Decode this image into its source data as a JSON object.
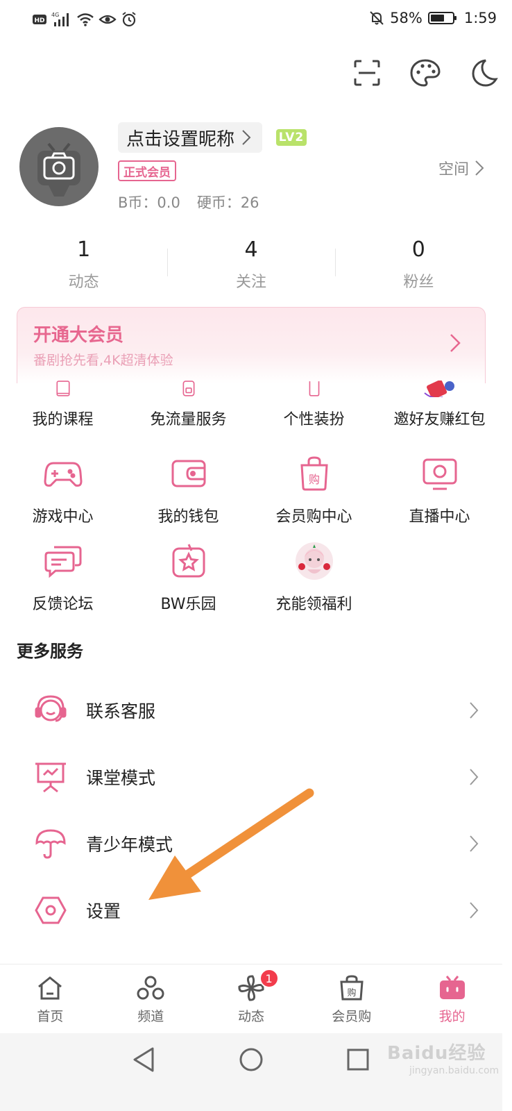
{
  "colors": {
    "accent": "#e66590",
    "vip": "#e7678f",
    "orange_arrow": "#f0913a",
    "badge": "#f23c4c"
  },
  "status_bar": {
    "icons": [
      "hd-icon",
      "signal-4g-icon",
      "wifi-icon",
      "eye-icon",
      "alarm-icon"
    ],
    "battery_text": "58%",
    "battery_level": 0.58,
    "time": "1:59"
  },
  "header_icons": [
    "scan-icon",
    "palette-icon",
    "night-mode-icon"
  ],
  "profile": {
    "nickname": "点击设置昵称",
    "level": "LV2",
    "member_badge": "正式会员",
    "bcoin_label": "B币：0.0",
    "coin_label": "硬币：26",
    "space_link": "空间"
  },
  "stats": [
    {
      "value": "1",
      "label": "动态"
    },
    {
      "value": "4",
      "label": "关注"
    },
    {
      "value": "0",
      "label": "粉丝"
    }
  ],
  "vip_banner": {
    "title": "开通大会员",
    "subtitle": "番剧抢先看,4K超清体验"
  },
  "grid": {
    "row1": [
      {
        "label": "我的课程",
        "icon": "course-icon"
      },
      {
        "label": "免流量服务",
        "icon": "free-data-icon"
      },
      {
        "label": "个性装扮",
        "icon": "outfit-icon"
      },
      {
        "label": "邀好友赚红包",
        "icon": "invite-red-packet-icon"
      }
    ],
    "row2": [
      {
        "label": "游戏中心",
        "icon": "gamepad-icon"
      },
      {
        "label": "我的钱包",
        "icon": "wallet-icon"
      },
      {
        "label": "会员购中心",
        "icon": "shopping-bag-icon"
      },
      {
        "label": "直播中心",
        "icon": "live-tv-icon"
      }
    ],
    "row3": [
      {
        "label": "反馈论坛",
        "icon": "feedback-icon"
      },
      {
        "label": "BW乐园",
        "icon": "star-badge-icon"
      },
      {
        "label": "充能领福利",
        "icon": "character-avatar-icon"
      }
    ]
  },
  "more_services": {
    "title": "更多服务",
    "items": [
      {
        "label": "联系客服",
        "icon": "headset-icon"
      },
      {
        "label": "课堂模式",
        "icon": "classroom-icon"
      },
      {
        "label": "青少年模式",
        "icon": "umbrella-icon"
      },
      {
        "label": "设置",
        "icon": "settings-hex-icon"
      }
    ]
  },
  "tabbar": [
    {
      "label": "首页",
      "icon": "home-icon"
    },
    {
      "label": "频道",
      "icon": "channel-icon"
    },
    {
      "label": "动态",
      "icon": "dynamic-icon",
      "badge": "1"
    },
    {
      "label": "会员购",
      "icon": "shop-icon"
    },
    {
      "label": "我的",
      "icon": "mine-tv-icon",
      "active": true
    }
  ],
  "nav_bar": [
    "back-icon",
    "home-circle-icon",
    "recent-apps-icon"
  ],
  "watermark": {
    "text": "Baidu经验",
    "sub": "jingyan.baidu.com"
  }
}
